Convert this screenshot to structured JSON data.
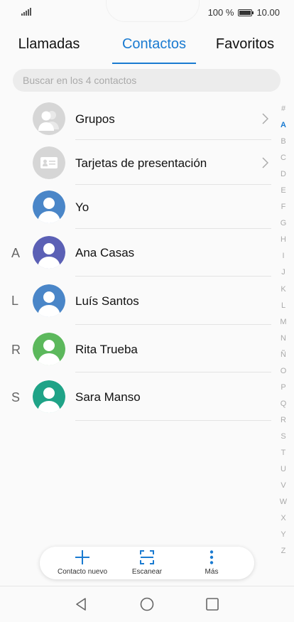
{
  "status": {
    "battery": "100 %",
    "time": "10.00"
  },
  "tabs": [
    {
      "label": "Llamadas"
    },
    {
      "label": "Contactos"
    },
    {
      "label": "Favoritos"
    }
  ],
  "search": {
    "placeholder": "Buscar en los 4 contactos"
  },
  "list": {
    "groups": {
      "label": "Grupos"
    },
    "cards": {
      "label": "Tarjetas de presentación"
    },
    "me": {
      "label": "Yo",
      "color": "#4a86c8"
    },
    "contacts": [
      {
        "section": "A",
        "name": "Ana Casas",
        "color": "#5b60b5"
      },
      {
        "section": "L",
        "name": "Luís Santos",
        "color": "#4a86c8"
      },
      {
        "section": "R",
        "name": "Rita Trueba",
        "color": "#5cb85c"
      },
      {
        "section": "S",
        "name": "Sara Manso",
        "color": "#1fa387"
      }
    ]
  },
  "index_letters": [
    "#",
    "A",
    "B",
    "C",
    "D",
    "E",
    "F",
    "G",
    "H",
    "I",
    "J",
    "K",
    "L",
    "M",
    "N",
    "Ñ",
    "O",
    "P",
    "Q",
    "R",
    "S",
    "T",
    "U",
    "V",
    "W",
    "X",
    "Y",
    "Z"
  ],
  "index_active": "A",
  "actions": [
    {
      "label": "Contacto nuevo",
      "icon": "plus-icon"
    },
    {
      "label": "Escanear",
      "icon": "scan-icon"
    },
    {
      "label": "Más",
      "icon": "more-vertical-icon"
    }
  ],
  "accent": "#1a7bd1"
}
